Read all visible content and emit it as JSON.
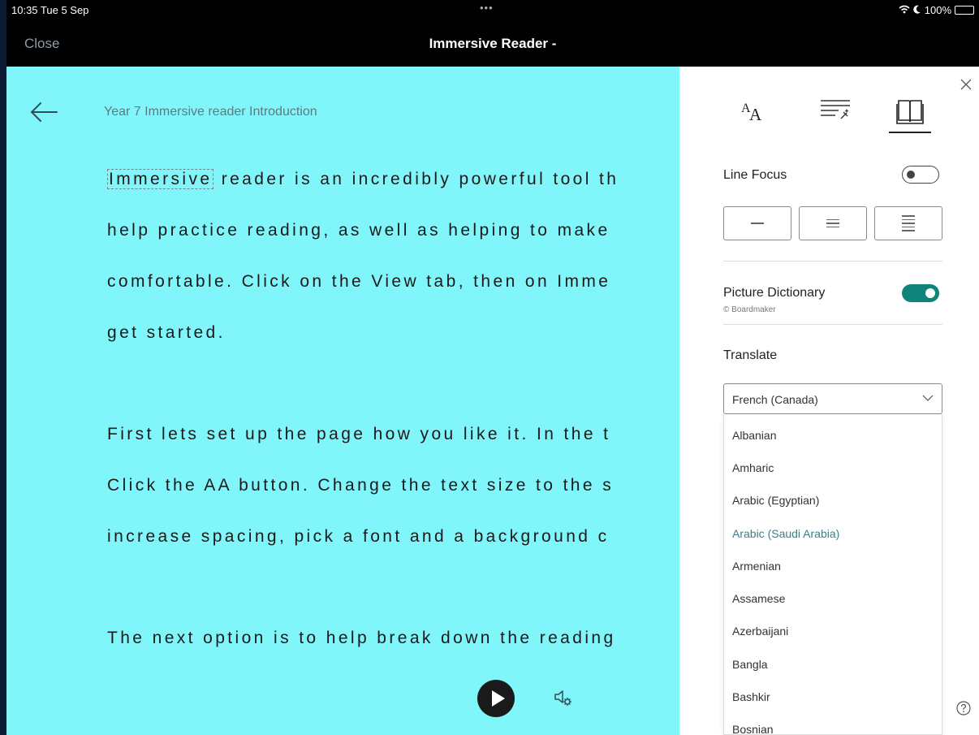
{
  "status_bar": {
    "time": "10:35  Tue 5 Sep",
    "dots": "•••",
    "battery": "100%"
  },
  "nav": {
    "close": "Close",
    "title": "Immersive Reader -"
  },
  "reader": {
    "doc_title": "Year 7 Immersive reader Introduction",
    "highlighted_word": "Immersive",
    "lines": [
      " reader is an incredibly powerful tool th",
      "help practice reading, as well as helping to make",
      "comfortable. Click on the View tab, then on Imme",
      "get started.",
      "First lets set up the page how you like it. In the t",
      "Click the AA button. Change the text size to the s",
      "increase spacing, pick a font and a background c",
      "The next option is to help break down the reading"
    ],
    "background": "#80f6fb"
  },
  "panel": {
    "line_focus": "Line Focus",
    "picture_dictionary": "Picture Dictionary",
    "picture_credit": "© Boardmaker",
    "translate": "Translate",
    "selected_language": "French (Canada)",
    "languages": [
      "Albanian",
      "Amharic",
      "Arabic (Egyptian)",
      "Arabic (Saudi Arabia)",
      "Armenian",
      "Assamese",
      "Azerbaijani",
      "Bangla",
      "Bashkir",
      "Bosnian"
    ],
    "highlighted_language": "Arabic (Saudi Arabia)",
    "accent": "#10837a"
  }
}
